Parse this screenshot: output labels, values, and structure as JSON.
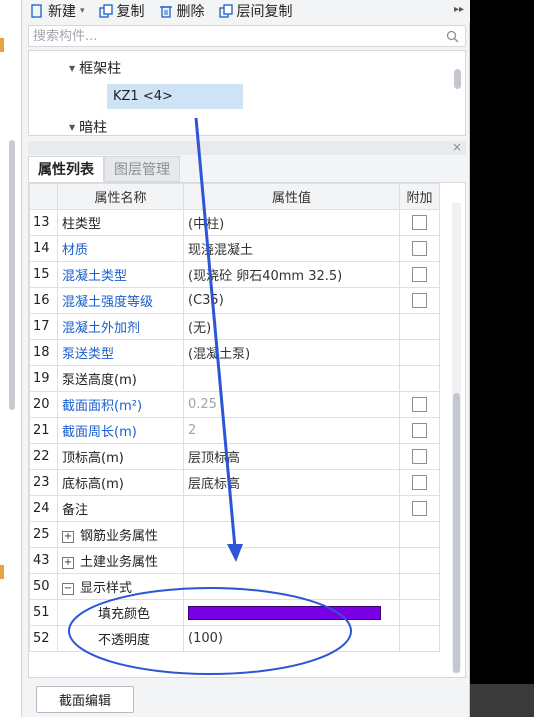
{
  "toolbar": {
    "new_label": "新建",
    "copy_label": "复制",
    "delete_label": "删除",
    "floor_copy_label": "层间复制"
  },
  "search": {
    "placeholder": "搜索构件..."
  },
  "tree": {
    "group1": "框架柱",
    "selected_item": "KZ1 <4>",
    "group2": "暗柱"
  },
  "tabs": [
    {
      "label": "属性列表",
      "active": true
    },
    {
      "label": "图层管理",
      "active": false
    }
  ],
  "columns": {
    "name": "属性名称",
    "value": "属性值",
    "extra": "附加"
  },
  "rows": [
    {
      "num": "13",
      "name": "柱类型",
      "value": "(中柱)",
      "checkbox": true,
      "blue": false
    },
    {
      "num": "14",
      "name": "材质",
      "value": "现浇混凝土",
      "checkbox": true,
      "blue": true
    },
    {
      "num": "15",
      "name": "混凝土类型",
      "value": "(现浇砼 卵石40mm 32.5)",
      "checkbox": true,
      "blue": true
    },
    {
      "num": "16",
      "name": "混凝土强度等级",
      "value": "(C35)",
      "checkbox": true,
      "blue": true
    },
    {
      "num": "17",
      "name": "混凝土外加剂",
      "value": "(无)",
      "checkbox": false,
      "blue": true
    },
    {
      "num": "18",
      "name": "泵送类型",
      "value": "(混凝土泵)",
      "checkbox": false,
      "blue": true
    },
    {
      "num": "19",
      "name": "泵送高度(m)",
      "value": "",
      "checkbox": false,
      "blue": false
    },
    {
      "num": "20",
      "name": "截面面积(m²)",
      "value": "0.25",
      "checkbox": true,
      "blue": true,
      "gray": true
    },
    {
      "num": "21",
      "name": "截面周长(m)",
      "value": "2",
      "checkbox": true,
      "blue": true,
      "gray": true
    },
    {
      "num": "22",
      "name": "顶标高(m)",
      "value": "层顶标高",
      "checkbox": true,
      "blue": false
    },
    {
      "num": "23",
      "name": "底标高(m)",
      "value": "层底标高",
      "checkbox": true,
      "blue": false
    },
    {
      "num": "24",
      "name": "备注",
      "value": "",
      "checkbox": true,
      "blue": false
    },
    {
      "num": "25",
      "name": "钢筋业务属性",
      "value": "",
      "checkbox": false,
      "expander": "+"
    },
    {
      "num": "43",
      "name": "土建业务属性",
      "value": "",
      "checkbox": false,
      "expander": "+"
    },
    {
      "num": "50",
      "name": "显示样式",
      "value": "",
      "checkbox": false,
      "expander": "−"
    },
    {
      "num": "51",
      "name": "填充颜色",
      "value": "",
      "checkbox": false,
      "indent": true,
      "swatch": "#7a00e6"
    },
    {
      "num": "52",
      "name": "不透明度",
      "value": "(100)",
      "checkbox": false,
      "indent": true
    }
  ],
  "bottom_button": "截面编辑",
  "colors": {
    "accent": "#1a5fcc",
    "fill_swatch": "#7a00e6",
    "annotation": "#2d55d6"
  }
}
